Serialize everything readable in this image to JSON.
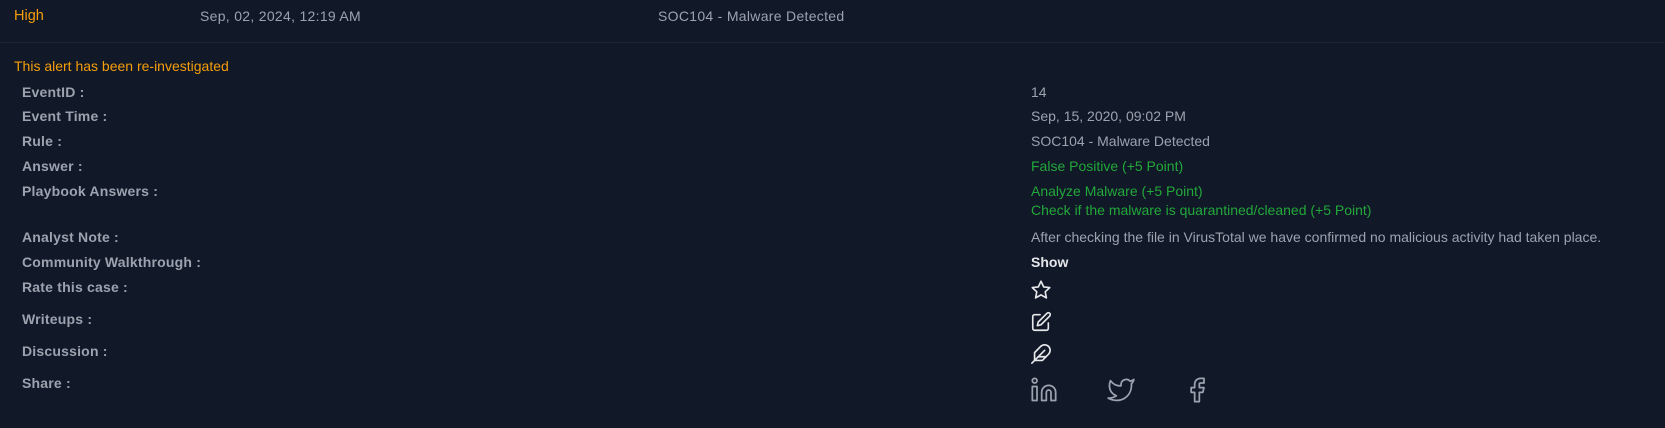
{
  "header": {
    "severity": "High",
    "date": "Sep, 02, 2024, 12:19 AM",
    "rule": "SOC104 - Malware Detected"
  },
  "notice": "This alert has been re-investigated",
  "fields": {
    "event_id": {
      "label": "EventID :",
      "value": "14"
    },
    "event_time": {
      "label": "Event Time :",
      "value": "Sep, 15, 2020, 09:02 PM"
    },
    "rule": {
      "label": "Rule :",
      "value": "SOC104 - Malware Detected"
    },
    "answer": {
      "label": "Answer :",
      "value": "False Positive (+5 Point)"
    },
    "playbook": {
      "label": "Playbook Answers :",
      "values": [
        "Analyze Malware (+5 Point)",
        "Check if the malware is quarantined/cleaned (+5 Point)"
      ]
    },
    "analyst_note": {
      "label": "Analyst Note :",
      "value": "After checking the file in VirusTotal we have confirmed no malicious activity had taken place."
    },
    "walkthrough": {
      "label": "Community Walkthrough :",
      "link": "Show"
    },
    "rate": {
      "label": "Rate this case :",
      "icon": "star-icon"
    },
    "writeups": {
      "label": "Writeups :",
      "icon": "edit-icon"
    },
    "discussion": {
      "label": "Discussion :",
      "icon": "feather-icon"
    },
    "share": {
      "label": "Share :",
      "icons": [
        "linkedin-icon",
        "twitter-icon",
        "facebook-icon"
      ]
    }
  },
  "colors": {
    "background": "#111827",
    "severity_high": "#f59e0b",
    "label": "#9ca3af",
    "value": "#9ca3af",
    "correct": "#22a83a",
    "link": "#e5e7eb"
  }
}
